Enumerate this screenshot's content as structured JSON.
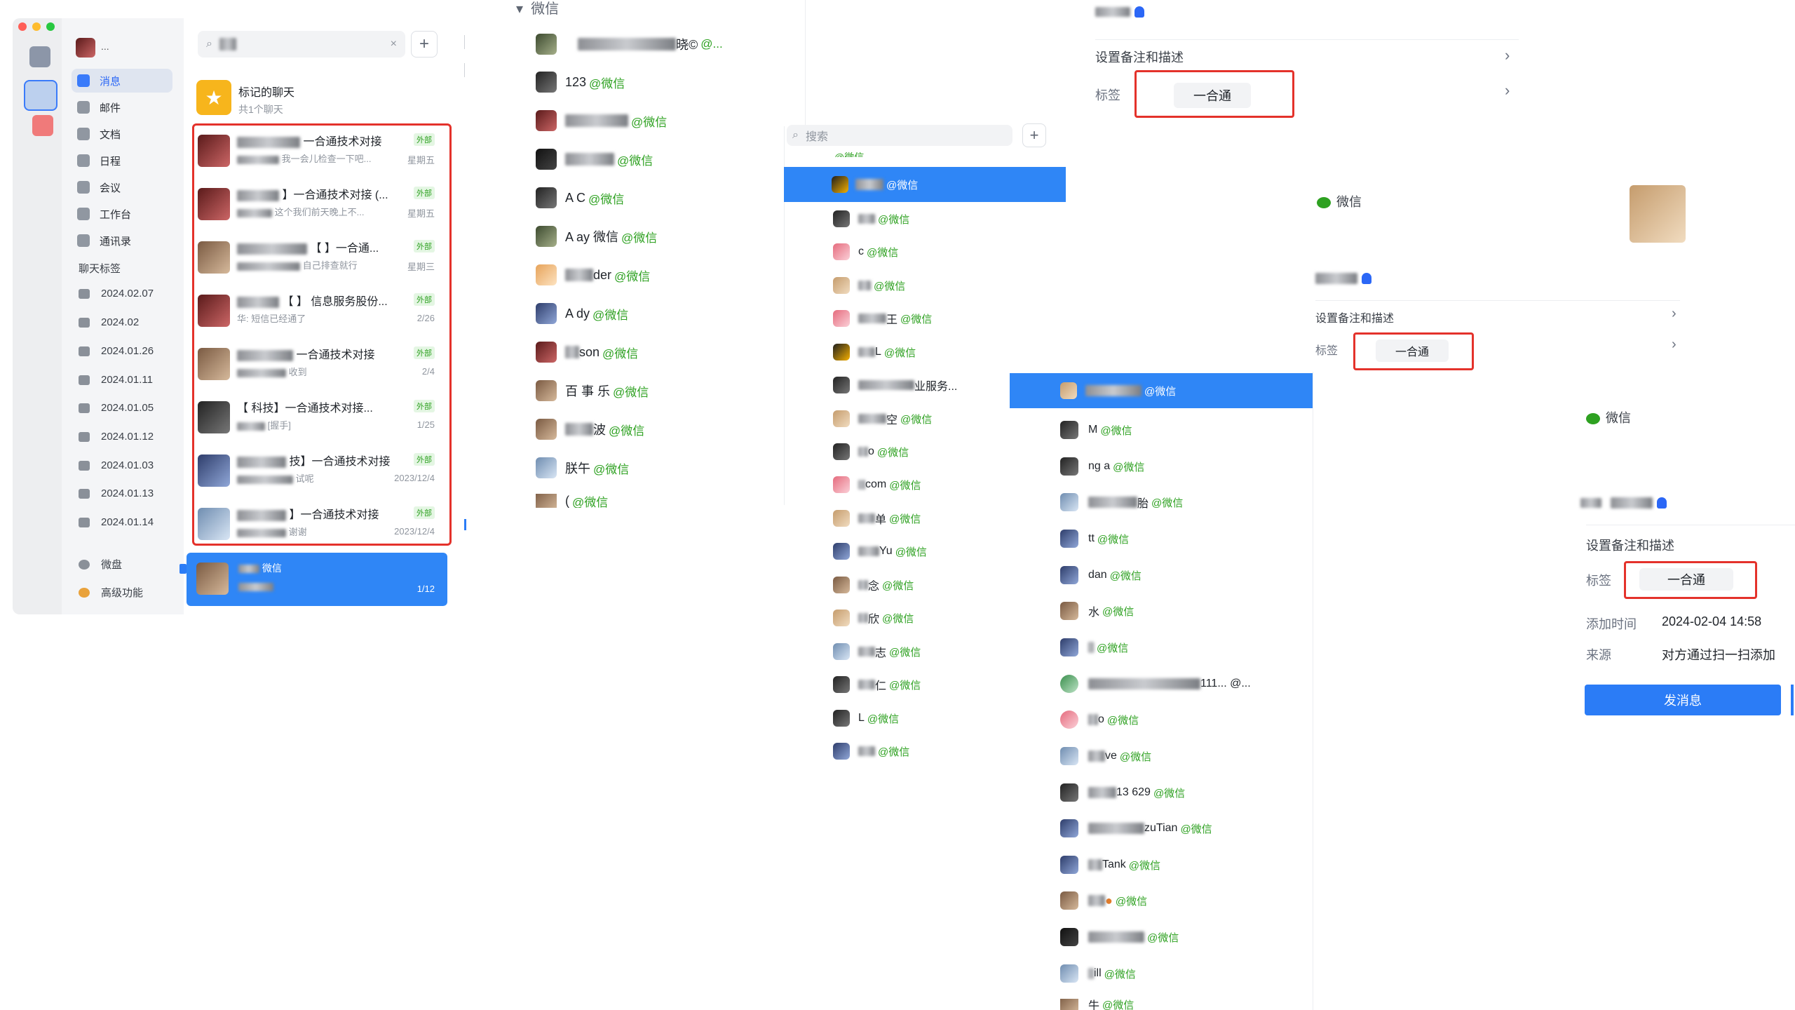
{
  "sidebar": {
    "username": "...",
    "nav": [
      "消息",
      "邮件",
      "文档",
      "日程",
      "会议",
      "工作台",
      "通讯录"
    ],
    "section_title": "聊天标签",
    "tags": [
      "2024.02.07",
      "2024.02",
      "2024.01.26",
      "2024.01.11",
      "2024.01.05",
      "2024.01.12",
      "2024.01.03",
      "2024.01.13",
      "2024.01.14"
    ],
    "bottom": [
      "微盘",
      "高级功能"
    ]
  },
  "chatlist": {
    "starred_title": "标记的聊天",
    "starred_sub": "共1个聊天",
    "items": [
      {
        "title": "一合通技术对接",
        "sub": "我一会儿检查一下吧...",
        "ext": "外部",
        "time": "星期五"
      },
      {
        "title": "】一合通技术对接 (...",
        "sub": "这个我们前天晚上不...",
        "ext": "外部",
        "time": "星期五"
      },
      {
        "title": "【 】一合通...",
        "sub": "自己排查就行",
        "ext": "外部",
        "time": "星期三"
      },
      {
        "title": "【 】 信息服务股份...",
        "sub": "华: 短信已经通了",
        "ext": "外部",
        "time": "2/26"
      },
      {
        "title": "一合通技术对接",
        "sub": "收到",
        "ext": "外部",
        "time": "2/4"
      },
      {
        "title": "【 科技】一合通技术对接...",
        "sub": "[握手]",
        "ext": "外部",
        "time": "1/25"
      },
      {
        "title": "技】一合通技术对接",
        "sub": "试呢",
        "ext": "外部",
        "time": "2023/12/4"
      },
      {
        "title": "】一合通技术对接",
        "sub": "谢谢",
        "ext": "外部",
        "time": "2023/12/4"
      }
    ],
    "selected_title": "微信",
    "selected_time": "1/12"
  },
  "contacts1": {
    "header": "微信",
    "wx": "@微信",
    "items": [
      "晓©",
      "123",
      "",
      "",
      "A C",
      "A ay 微信",
      "der",
      "A dy",
      "son",
      "百 事 乐",
      "波",
      "朕午",
      "("
    ]
  },
  "contacts2": {
    "search_placeholder": "搜索",
    "wx": "@微信",
    "items": [
      "",
      "",
      "c",
      "",
      "",
      "王",
      "L",
      "业服务...",
      "空",
      "o",
      "com",
      "单",
      "Yu",
      "念",
      "欣",
      "志",
      "仁",
      "L",
      "",
      ""
    ]
  },
  "contacts3": {
    "wx": "@微信",
    "items": [
      "",
      "M",
      "ng a",
      "胎",
      "tt",
      "dan",
      "水",
      "",
      "111... @...",
      "o",
      "ve",
      "13 629",
      "zuTian",
      "Tank",
      "",
      "",
      "ill",
      "牛"
    ]
  },
  "detail1": {
    "remark": "设置备注和描述",
    "tag_label": "标签",
    "tag_value": "一合通"
  },
  "detail2": {
    "wx": "微信",
    "remark": "设置备注和描述",
    "tag_label": "标签",
    "tag_value": "一合通"
  },
  "detail3": {
    "wx": "微信",
    "remark": "设置备注和描述",
    "tag_label": "标签",
    "tag_value": "一合通",
    "add_time_label": "添加时间",
    "add_time": "2024-02-04 14:58",
    "source_label": "来源",
    "source": "对方通过扫一扫添加",
    "send_button": "发消息"
  }
}
